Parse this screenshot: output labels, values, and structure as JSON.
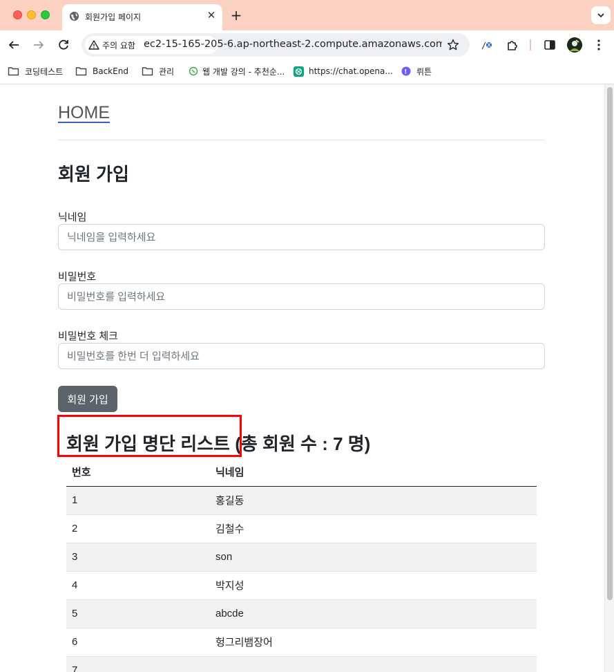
{
  "browser": {
    "tab_title": "회원가입 페이지",
    "security_chip": "주의 요함",
    "url": "ec2-15-165-205-6.ap-northeast-2.compute.amazonaws.com:8...",
    "bookmarks": [
      {
        "label": "코딩테스트",
        "icon": "folder-icon"
      },
      {
        "label": "BackEnd",
        "icon": "folder-icon"
      },
      {
        "label": "관리",
        "icon": "folder-icon"
      },
      {
        "label": "웹 개발 강의 - 추천순...",
        "icon": "site-icon"
      },
      {
        "label": "https://chat.opena...",
        "icon": "chatgpt-icon"
      },
      {
        "label": "뤼튼",
        "icon": "wrtn-icon"
      }
    ]
  },
  "page": {
    "home_link": "HOME",
    "title": "회원 가입",
    "form": {
      "nickname_label": "닉네임",
      "nickname_placeholder": "닉네임을 입력하세요",
      "password_label": "비밀번호",
      "password_placeholder": "비밀번호를 입력하세요",
      "password_check_label": "비밀번호 체크",
      "password_check_placeholder": "비밀번호를 한번 더 입력하세요",
      "submit_label": "회원 가입"
    },
    "list": {
      "heading": "회원 가입 명단 리스트",
      "count_text": "(총 회원 수 : 7 명)",
      "columns": [
        "번호",
        "닉네임"
      ],
      "rows": [
        {
          "no": "1",
          "nickname": "홍길동"
        },
        {
          "no": "2",
          "nickname": "김철수"
        },
        {
          "no": "3",
          "nickname": "son"
        },
        {
          "no": "4",
          "nickname": "박지성"
        },
        {
          "no": "5",
          "nickname": "abcde"
        },
        {
          "no": "6",
          "nickname": "헝그리뱀장어"
        },
        {
          "no": "7",
          "nickname": ""
        }
      ]
    }
  },
  "colors": {
    "tabbar": "#fbd2c2",
    "button": "#5c636a",
    "highlight": "#ff0000"
  }
}
